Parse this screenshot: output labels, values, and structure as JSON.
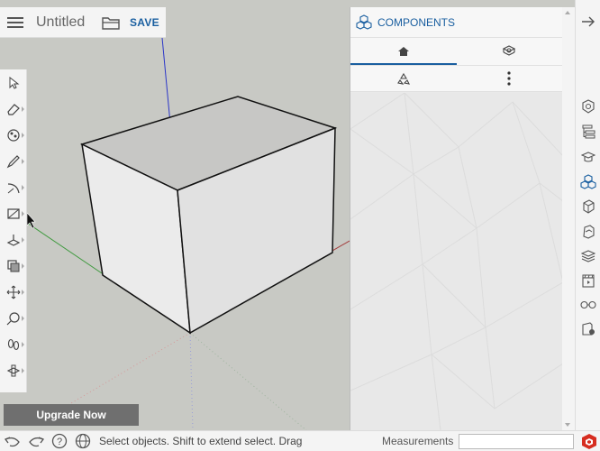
{
  "app": {
    "title": "Untitled",
    "save_label": "SAVE"
  },
  "toolbar": {
    "tools": [
      {
        "name": "select-tool",
        "icon": "arrow-cursor-icon"
      },
      {
        "name": "eraser-tool",
        "icon": "eraser-icon"
      },
      {
        "name": "paint-tool",
        "icon": "paint-bucket-icon"
      },
      {
        "name": "line-tool",
        "icon": "pencil-icon"
      },
      {
        "name": "arc-tool",
        "icon": "arc-icon"
      },
      {
        "name": "rectangle-tool",
        "icon": "rectangle-icon"
      },
      {
        "name": "push-pull-tool",
        "icon": "push-pull-icon"
      },
      {
        "name": "offset-tool",
        "icon": "offset-icon"
      },
      {
        "name": "move-tool",
        "icon": "move-icon"
      },
      {
        "name": "tape-measure-tool",
        "icon": "tape-measure-icon"
      },
      {
        "name": "walk-tool",
        "icon": "footprints-icon"
      },
      {
        "name": "section-plane-tool",
        "icon": "section-plane-icon"
      }
    ]
  },
  "upgrade": {
    "label": "Upgrade Now"
  },
  "panel": {
    "title": "COMPONENTS",
    "tabs": [
      {
        "icon": "home-icon",
        "active": true
      },
      {
        "icon": "in-model-components-icon",
        "active": false
      }
    ],
    "subbar": [
      {
        "icon": "purge-recycle-icon"
      },
      {
        "icon": "more-vertical-icon"
      }
    ]
  },
  "rightbar": {
    "icons": [
      "collapse-arrow-icon",
      "entity-info-icon",
      "outliner-icon",
      "instructor-icon",
      "components-icon",
      "materials-icon",
      "styles-icon",
      "tags-icon",
      "scenes-icon",
      "display-icon",
      "solar-shadows-icon"
    ]
  },
  "status": {
    "text": "Select objects. Shift to extend select. Drag",
    "measurements_label": "Measurements",
    "measurements_value": ""
  },
  "colors": {
    "accent": "#1a5fa0",
    "viewport_bg": "#c8c9c4",
    "axis_red": "#a33b3b",
    "axis_green": "#3f9a3f",
    "axis_blue": "#2a35c8"
  }
}
